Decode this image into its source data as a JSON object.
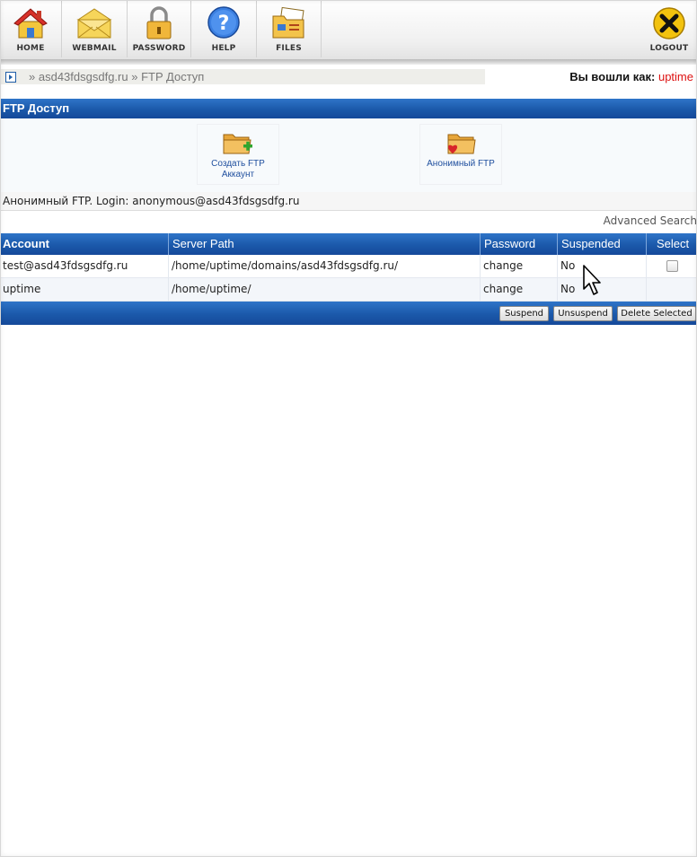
{
  "nav": {
    "items": [
      {
        "label": "HOME",
        "icon": "home-icon"
      },
      {
        "label": "WEBMAIL",
        "icon": "envelope-icon"
      },
      {
        "label": "PASSWORD",
        "icon": "padlock-icon"
      },
      {
        "label": "HELP",
        "icon": "help-icon"
      },
      {
        "label": "FILES",
        "icon": "files-icon"
      }
    ],
    "logout": {
      "label": "LOGOUT",
      "icon": "close-icon"
    }
  },
  "breadcrumb": {
    "separator": "»",
    "domain": "asd43fdsgsdfg.ru",
    "page": "FTP Доступ"
  },
  "session": {
    "logged_in_label": "Вы вошли как:",
    "user": "uptime"
  },
  "section": {
    "title": "FTP Доступ"
  },
  "actions": [
    {
      "label": "Создать FTP Аккаунт",
      "icon": "folder-add-icon"
    },
    {
      "label": "Анонимный FTP",
      "icon": "folder-heart-icon"
    }
  ],
  "anon_info": "Анонимный FTP. Login: anonymous@asd43fdsgsdfg.ru",
  "advanced_search": "Advanced Search",
  "table": {
    "columns": [
      "Account",
      "Server Path",
      "Password",
      "Suspended",
      "Select"
    ],
    "rows": [
      {
        "account": "test@asd43fdsgsdfg.ru",
        "path": "/home/uptime/domains/asd43fdsgsdfg.ru/",
        "password": "change",
        "suspended": "No",
        "has_checkbox": true
      },
      {
        "account": "uptime",
        "path": "/home/uptime/",
        "password": "change",
        "suspended": "No",
        "has_checkbox": false
      }
    ],
    "buttons": {
      "suspend": "Suspend",
      "unsuspend": "Unsuspend",
      "delete": "Delete Selected"
    }
  },
  "colors": {
    "header_blue": "#1b59aa",
    "link_blue": "#1f4f9e",
    "user_red": "#dd1111"
  }
}
